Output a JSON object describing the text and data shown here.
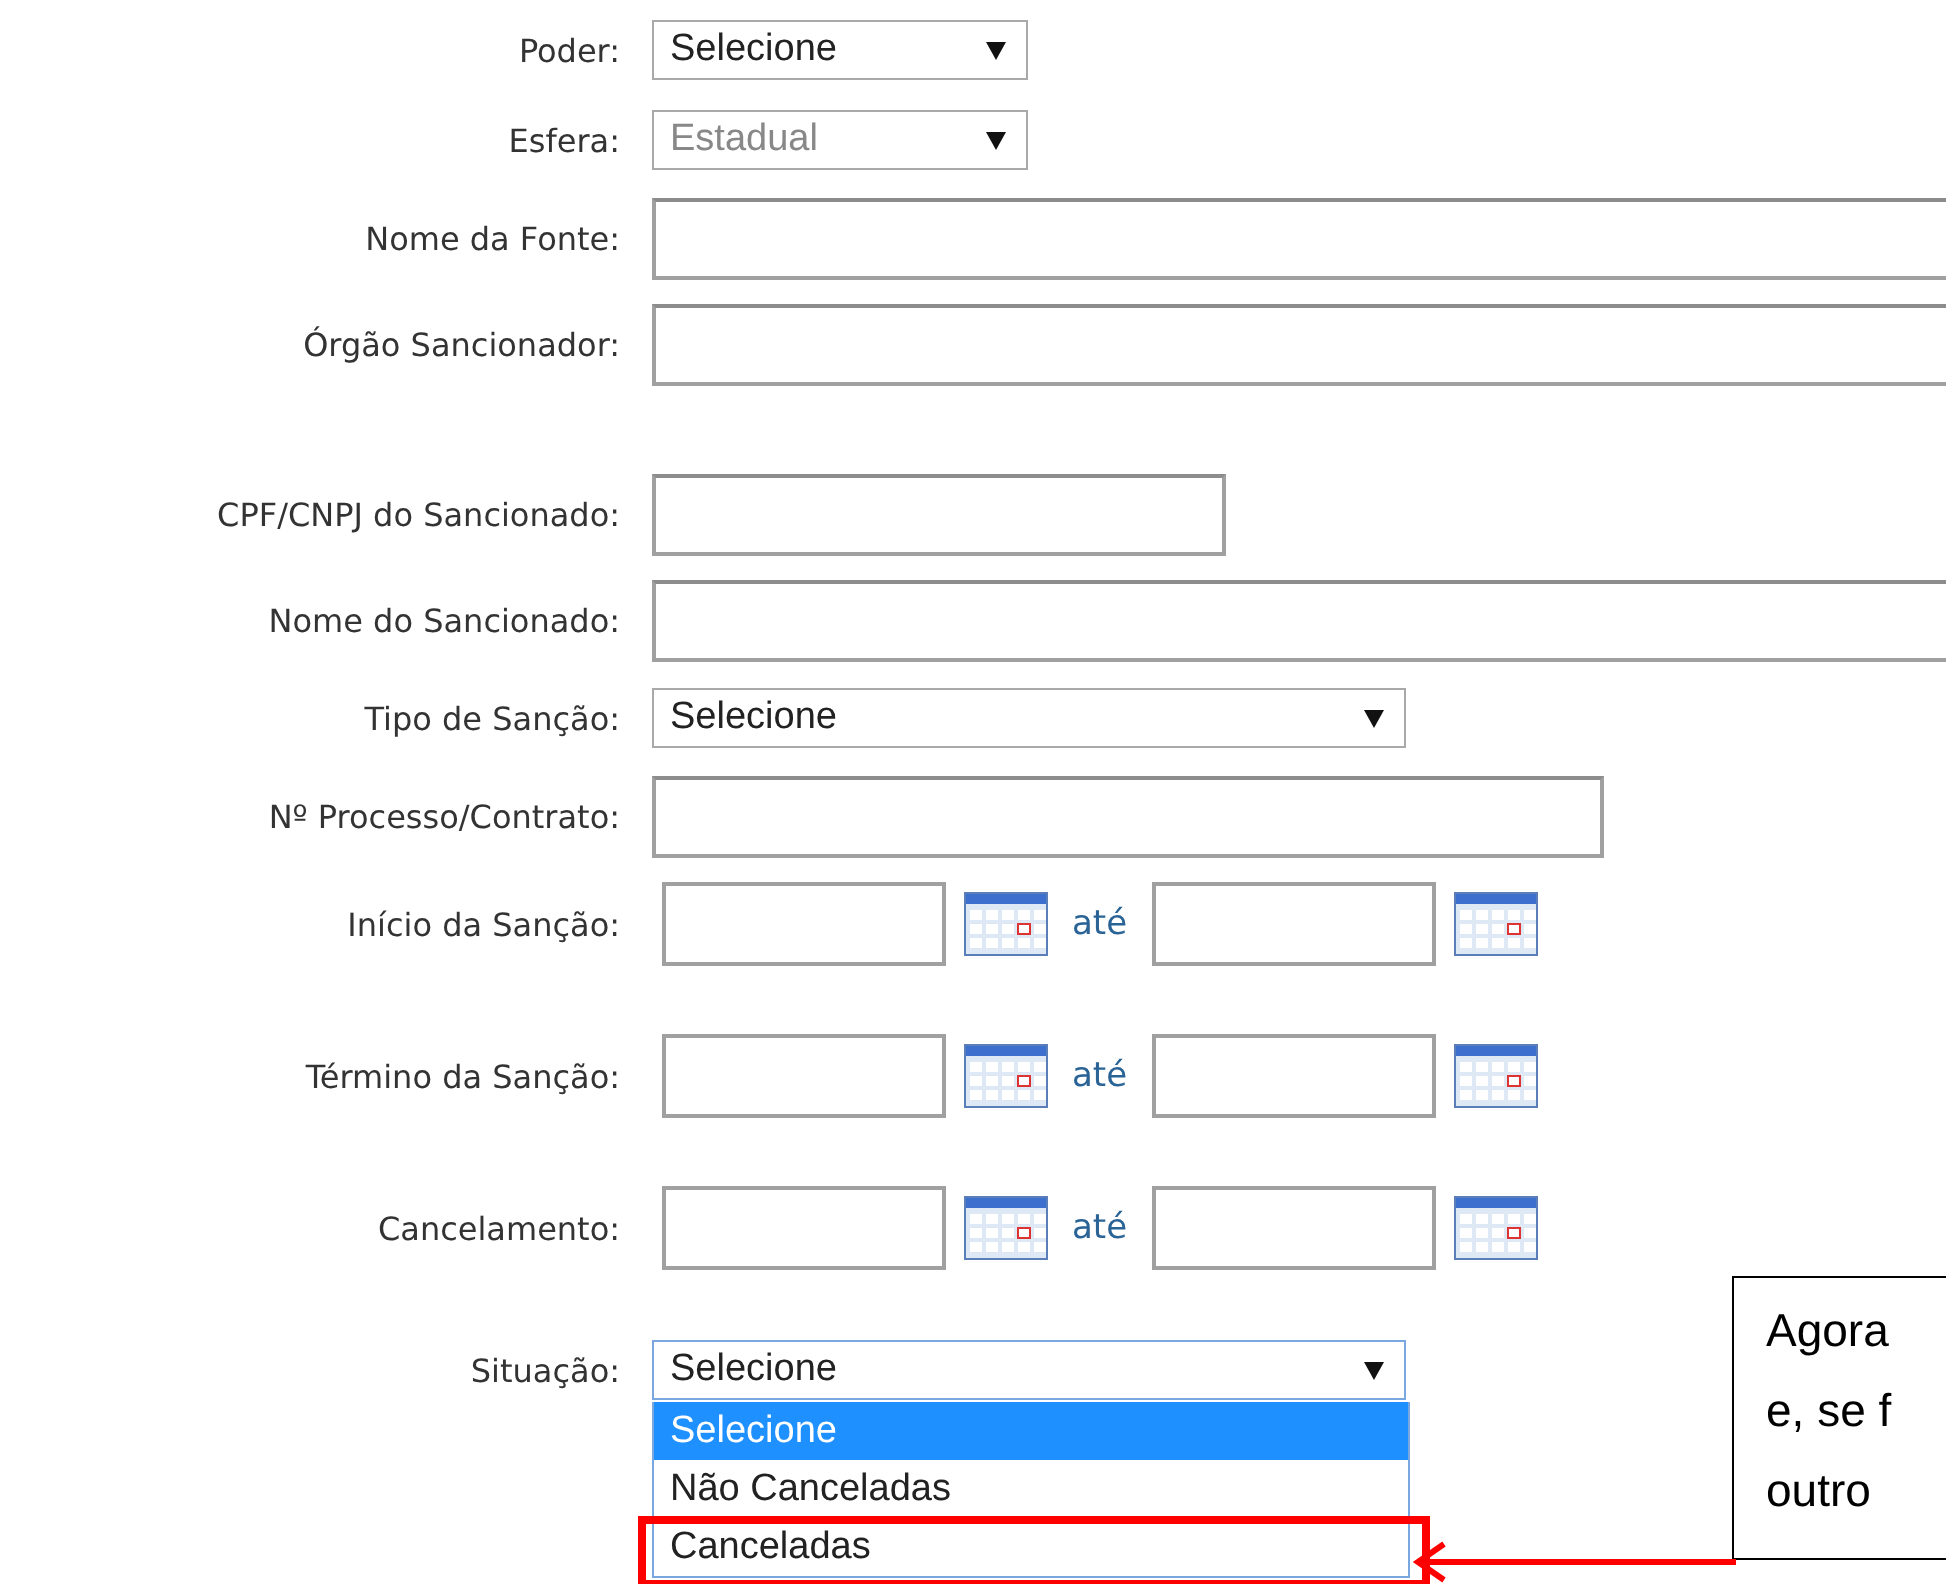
{
  "source_fields": [
    {
      "kind": "select",
      "label": "Poder:",
      "value": "Selecione",
      "disabled": false
    },
    {
      "kind": "select",
      "label": "Esfera:",
      "value": "Estadual",
      "disabled": true
    },
    {
      "kind": "text",
      "label": "Nome da Fonte:"
    },
    {
      "kind": "text",
      "label": "Órgão Sancionador:"
    }
  ],
  "sanctioned_fields": [
    {
      "kind": "text",
      "label": "CPF/CNPJ do Sancionado:"
    },
    {
      "kind": "text",
      "label": "Nome do Sancionado:"
    },
    {
      "kind": "select",
      "label": "Tipo de Sanção:",
      "value": "Selecione",
      "disabled": false
    },
    {
      "kind": "text",
      "label": "Nº Processo/Contrato:"
    },
    {
      "kind": "daterange",
      "label": "Início da Sanção:",
      "separator": "até"
    },
    {
      "kind": "daterange",
      "label": "Término da Sanção:",
      "separator": "até"
    },
    {
      "kind": "daterange",
      "label": "Cancelamento:",
      "separator": "até"
    },
    {
      "kind": "select",
      "label": "Situação:",
      "value": "Selecione",
      "disabled": false,
      "expanded": true,
      "options": [
        {
          "label": "Selecione",
          "selected": true,
          "highlighted": false
        },
        {
          "label": "Não Canceladas",
          "selected": false,
          "highlighted": false
        },
        {
          "label": "Canceladas",
          "selected": false,
          "highlighted": true
        }
      ]
    }
  ],
  "callout": {
    "lines": [
      "Agora",
      "e, se f",
      "outro"
    ]
  }
}
